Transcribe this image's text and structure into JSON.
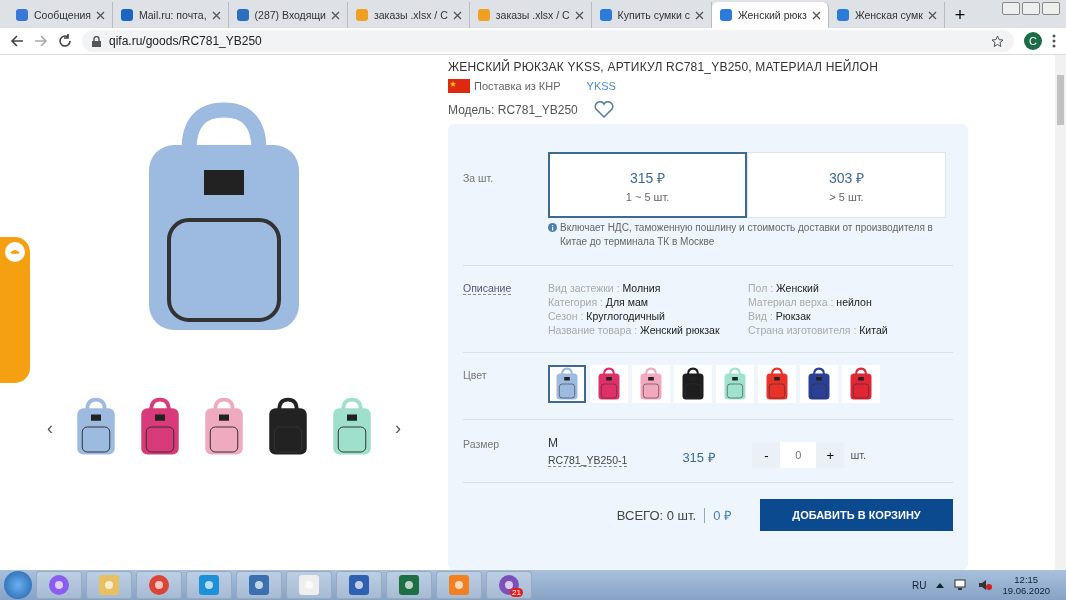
{
  "browser": {
    "tabs": [
      {
        "title": "Сообщения",
        "kind": "messages",
        "selected": false
      },
      {
        "title": "Mail.ru: почта,",
        "kind": "mail",
        "selected": false
      },
      {
        "title": "(287) Входящи",
        "kind": "inbox",
        "selected": false
      },
      {
        "title": "заказы .xlsx / С",
        "kind": "sheet",
        "selected": false
      },
      {
        "title": "заказы .xlsx / С",
        "kind": "sheet",
        "selected": false
      },
      {
        "title": "Купить сумки с",
        "kind": "site",
        "selected": false
      },
      {
        "title": "Женский рюкз",
        "kind": "site",
        "selected": true
      },
      {
        "title": "Женская сумк",
        "kind": "site",
        "selected": false
      }
    ],
    "new_tab": "+",
    "url": "qifa.ru/goods/RC781_YB250",
    "profile": "C"
  },
  "product": {
    "title": "ЖЕНСКИЙ РЮКЗАК YKSS, АРТИКУЛ RC781_YB250, МАТЕРИАЛ НЕЙЛОН",
    "origin": "Поставка из КНР",
    "brand": "YKSS",
    "model": "Модель: RC781_YB250",
    "gallery_prev": "‹",
    "gallery_next": "›",
    "gallery": [
      {
        "color": "#9dbbe0"
      },
      {
        "color": "#d83a7a"
      },
      {
        "color": "#f0aac0"
      },
      {
        "color": "#222222"
      },
      {
        "color": "#9fe0cc"
      }
    ]
  },
  "price": {
    "label": "За шт.",
    "tiers": [
      {
        "price": "315 ₽",
        "range": "1 ~ 5 шт.",
        "selected": true
      },
      {
        "price": "303 ₽",
        "range": "> 5 шт.",
        "selected": false
      }
    ],
    "note": "Включает НДС, таможенную пошлину и стоимость доставки от производителя в Китае до терминала ТК в Москве"
  },
  "description": {
    "label": "Описание",
    "specs": [
      {
        "name": "Вид застежки :",
        "value": "Молния"
      },
      {
        "name": "Пол :",
        "value": "Женский"
      },
      {
        "name": "Категория :",
        "value": "Для мам"
      },
      {
        "name": "Материал верха :",
        "value": "нейлон"
      },
      {
        "name": "Сезон :",
        "value": "Круглогодичный"
      },
      {
        "name": "Вид :",
        "value": "Рюкзак"
      },
      {
        "name": "Название товара :",
        "value": "Женский рюкзак"
      },
      {
        "name": "Страна изготовителя :",
        "value": "Китай"
      }
    ]
  },
  "colors": {
    "label": "Цвет",
    "swatches": [
      {
        "color": "#9dbbe0",
        "selected": true
      },
      {
        "color": "#e0306a",
        "selected": false
      },
      {
        "color": "#f2a8bf",
        "selected": false
      },
      {
        "color": "#1e1e1e",
        "selected": false
      },
      {
        "color": "#9fe3cf",
        "selected": false
      },
      {
        "color": "#e8322a",
        "selected": false
      },
      {
        "color": "#2a3f96",
        "selected": false
      },
      {
        "color": "#e02535",
        "selected": false
      }
    ]
  },
  "size": {
    "label": "Размер",
    "name": "M",
    "sku": "RC781_YB250-1",
    "price": "315 ₽",
    "minus": "-",
    "quantity": "0",
    "plus": "+",
    "unit": "шт."
  },
  "total": {
    "count": "ВСЕГО: 0 шт.",
    "sum": "0 ₽",
    "button": "ДОБАВИТЬ В КОРЗИНУ"
  },
  "taskbar": {
    "apps": [
      {
        "kind": "assistant"
      },
      {
        "kind": "folder"
      },
      {
        "kind": "chrome"
      },
      {
        "kind": "ie"
      },
      {
        "kind": "mail"
      },
      {
        "kind": "notepad"
      },
      {
        "kind": "network"
      },
      {
        "kind": "excel"
      },
      {
        "kind": "pdf"
      },
      {
        "kind": "viber",
        "badge": "21"
      }
    ],
    "language": "RU",
    "time": "12:15",
    "date": "19.06.2020"
  }
}
